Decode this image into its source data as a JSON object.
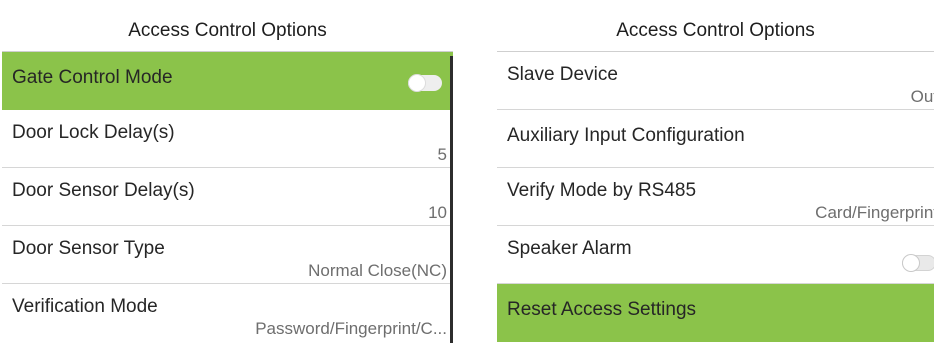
{
  "left_screen": {
    "title": "Access Control Options",
    "items": [
      {
        "label": "Gate Control Mode",
        "toggle_on": false,
        "highlighted": true
      },
      {
        "label": "Door Lock Delay(s)",
        "value": "5"
      },
      {
        "label": "Door Sensor Delay(s)",
        "value": "10"
      },
      {
        "label": "Door Sensor Type",
        "value": "Normal Close(NC)"
      },
      {
        "label": "Verification Mode",
        "value": "Password/Fingerprint/C..."
      }
    ]
  },
  "right_screen": {
    "title": "Access Control Options",
    "items": [
      {
        "label": "Slave Device",
        "value": "Out"
      },
      {
        "label": "Auxiliary Input Configuration"
      },
      {
        "label": "Verify Mode by RS485",
        "value": "Card/Fingerprint"
      },
      {
        "label": "Speaker Alarm",
        "toggle_on": false
      },
      {
        "label": "Reset Access Settings",
        "highlighted": true
      }
    ]
  },
  "colors": {
    "highlight": "#8bc34a",
    "divider": "#d6d6d6",
    "value_text": "#6e6e6e"
  }
}
